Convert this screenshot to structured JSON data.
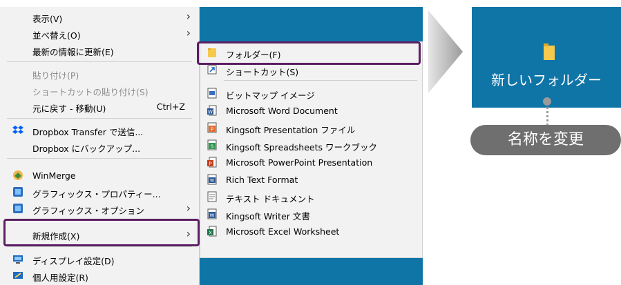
{
  "context_menu": {
    "items": [
      {
        "label": "表示(V)",
        "submenu": true
      },
      {
        "label": "並べ替え(O)",
        "submenu": true
      },
      {
        "label": "最新の情報に更新(E)"
      },
      {
        "label": "貼り付け(P)",
        "disabled": true
      },
      {
        "label": "ショートカットの貼り付け(S)",
        "disabled": true
      },
      {
        "label": "元に戻す - 移動(U)",
        "shortcut": "Ctrl+Z"
      },
      {
        "label": "Dropbox Transfer で送信...",
        "icon": "dropbox-icon"
      },
      {
        "label": "Dropbox にバックアップ..."
      },
      {
        "label": "WinMerge",
        "icon": "winmerge-icon"
      },
      {
        "label": "グラフィックス・プロパティー...",
        "icon": "graphics-icon"
      },
      {
        "label": "グラフィックス・オプション",
        "icon": "graphics-icon",
        "submenu": true
      },
      {
        "label": "新規作成(X)",
        "submenu": true,
        "highlighted": true
      },
      {
        "label": "ディスプレイ設定(D)",
        "icon": "display-icon"
      },
      {
        "label": "個人用設定(R)",
        "icon": "personalize-icon"
      }
    ]
  },
  "new_submenu": {
    "items": [
      {
        "label": "フォルダー(F)",
        "icon": "folder-icon",
        "highlighted": true
      },
      {
        "label": "ショートカット(S)",
        "icon": "shortcut-icon"
      },
      {
        "label": "ビットマップ イメージ",
        "icon": "bitmap-icon"
      },
      {
        "label": "Microsoft Word Document",
        "icon": "word-icon"
      },
      {
        "label": "Kingsoft Presentation ファイル",
        "icon": "kingsoft-presentation-icon"
      },
      {
        "label": "Kingsoft Spreadsheets ワークブック",
        "icon": "kingsoft-spreadsheet-icon"
      },
      {
        "label": "Microsoft PowerPoint Presentation",
        "icon": "powerpoint-icon"
      },
      {
        "label": "Rich Text Format",
        "icon": "rtf-icon"
      },
      {
        "label": "テキスト ドキュメント",
        "icon": "text-icon"
      },
      {
        "label": "Kingsoft Writer 文書",
        "icon": "kingsoft-writer-icon"
      },
      {
        "label": "Microsoft Excel Worksheet",
        "icon": "excel-icon"
      }
    ]
  },
  "preview": {
    "folder_label": "新しいフォルダー",
    "rename_label": "名称を変更"
  },
  "colors": {
    "desktop": "#0f75a7",
    "highlight_border": "#5b1e63",
    "menu_bg": "#f2f2f2"
  }
}
